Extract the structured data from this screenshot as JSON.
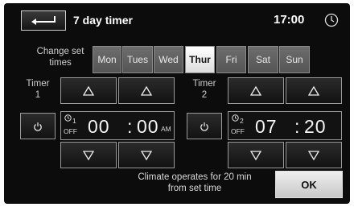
{
  "header": {
    "title": "7 day timer",
    "clock": "17:00"
  },
  "days": {
    "label_line1": "Change set",
    "label_line2": "times",
    "items": [
      "Mon",
      "Tues",
      "Wed",
      "Thur",
      "Fri",
      "Sat",
      "Sun"
    ],
    "selected": "Thur"
  },
  "timer1": {
    "label_line1": "Timer",
    "label_line2": "1",
    "badge_num": "1",
    "status": "OFF",
    "hours": "00",
    "minutes": "00",
    "ampm": "AM"
  },
  "timer2": {
    "label_line1": "Timer",
    "label_line2": "2",
    "badge_num": "2",
    "status": "OFF",
    "hours": "07",
    "minutes": "20",
    "ampm": ""
  },
  "footer": {
    "info_line1": "Climate operates for 20 min",
    "info_line2": "from set time",
    "ok_label": "OK"
  },
  "icons": {
    "back": "back-arrow-icon",
    "clock": "clock-icon",
    "power": "power-icon",
    "up": "triangle-up-icon",
    "down": "triangle-down-icon"
  }
}
